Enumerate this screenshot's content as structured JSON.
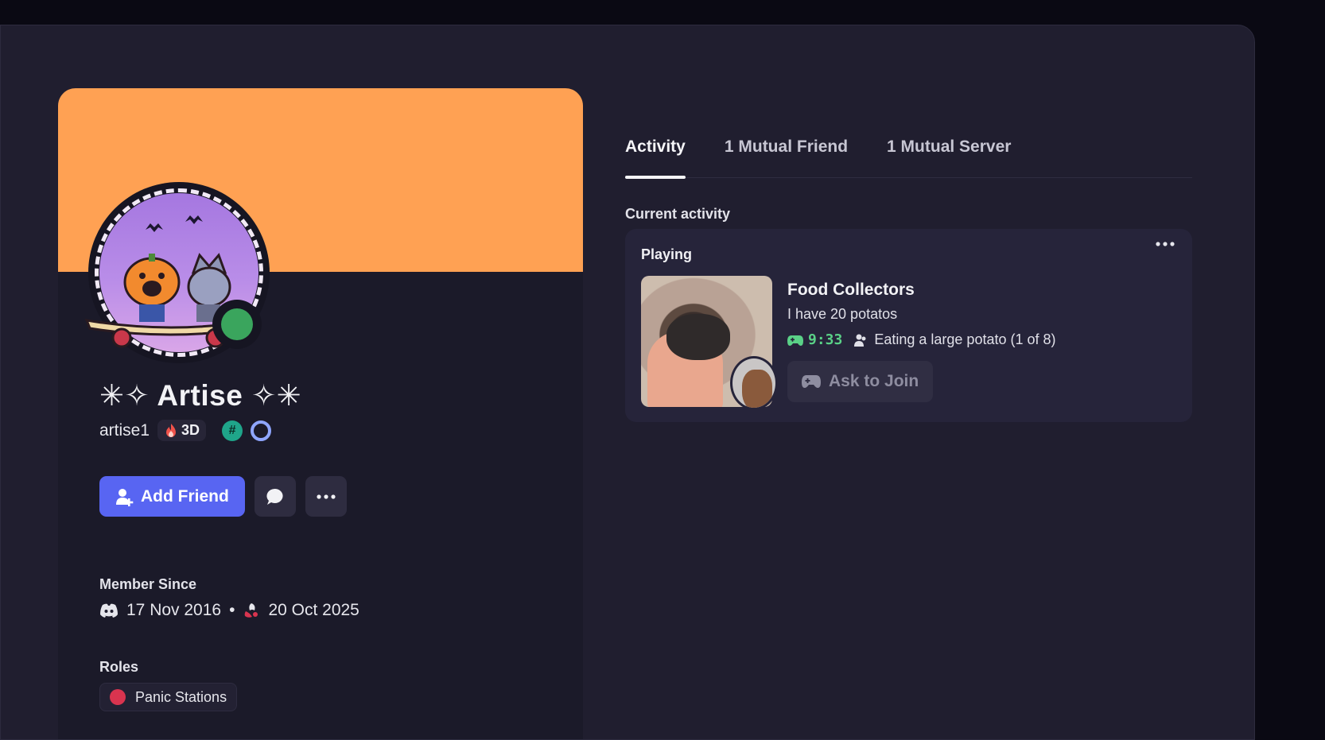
{
  "profile": {
    "display_name": "✳︎✧ Artise ✧✳︎",
    "username": "artise1",
    "streak_badge": "3D",
    "badges": [
      "hashtag-badge",
      "ring-badge"
    ],
    "banner_color": "#ffa153",
    "status": "online",
    "status_color": "#3aa55d"
  },
  "actions": {
    "add_friend": "Add Friend"
  },
  "member_since": {
    "label": "Member Since",
    "discord_date": "17 Nov 2016",
    "separator": "•",
    "server_date": "20 Oct 2025"
  },
  "roles": {
    "label": "Roles",
    "items": [
      {
        "name": "Panic Stations",
        "color": "#d9344f"
      }
    ]
  },
  "tabs": [
    {
      "label": "Activity",
      "active": true
    },
    {
      "label": "1 Mutual Friend",
      "active": false
    },
    {
      "label": "1 Mutual Server",
      "active": false
    }
  ],
  "activity": {
    "section_label": "Current activity",
    "status_label": "Playing",
    "game_title": "Food Collectors",
    "details": "I have 20 potatos",
    "elapsed": "9:33",
    "party_state": "Eating a large potato (1 of 8)",
    "join_button": "Ask to Join"
  },
  "colors": {
    "accent": "#5865f2",
    "timer_green": "#5ad187"
  }
}
